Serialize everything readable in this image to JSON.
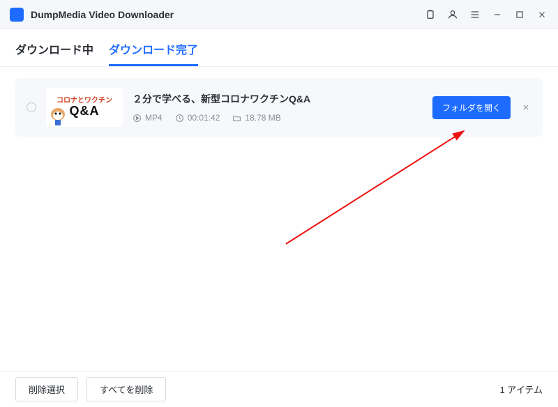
{
  "app": {
    "title": "DumpMedia Video Downloader"
  },
  "tabs": {
    "downloading": "ダウンロード中",
    "completed": "ダウンロード完了"
  },
  "item": {
    "title": "２分で学べる、新型コロナワクチンQ&A",
    "format": "MP4",
    "duration": "00:01:42",
    "size": "18.78 MB",
    "open_folder": "フォルダを開く",
    "thumb_line1": "コロナとワクチン",
    "thumb_qa": "Q&A"
  },
  "footer": {
    "delete_selection": "削除選択",
    "delete_all": "すべてを削除",
    "count_label": "1 アイテム"
  }
}
